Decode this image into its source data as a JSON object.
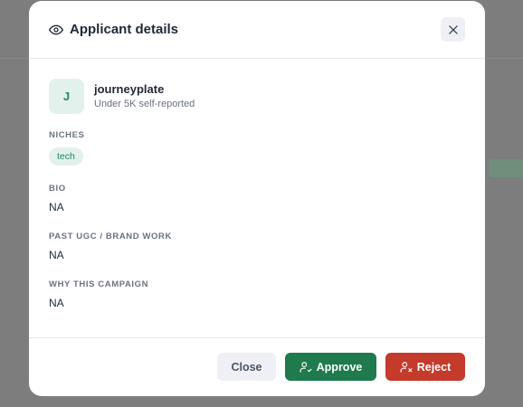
{
  "modal": {
    "title": "Applicant details",
    "title_icon": "eye-icon",
    "close_icon": "close-icon"
  },
  "applicant": {
    "initial": "J",
    "name": "journeyplate",
    "subtitle": "Under 5K self-reported"
  },
  "sections": {
    "niches_label": "NICHES",
    "niche_tags": [
      "tech"
    ],
    "bio_label": "BIO",
    "bio_value": "NA",
    "past_work_label": "PAST UGC / BRAND WORK",
    "past_work_value": "NA",
    "why_label": "WHY THIS CAMPAIGN",
    "why_value": "NA"
  },
  "footer": {
    "close_label": "Close",
    "approve_label": "Approve",
    "approve_icon": "user-check-icon",
    "reject_label": "Reject",
    "reject_icon": "user-x-icon"
  },
  "colors": {
    "approve": "#1f7a4d",
    "reject": "#c43a2b",
    "tag_bg": "#e3f1ec",
    "tag_text": "#1f8a5c"
  }
}
